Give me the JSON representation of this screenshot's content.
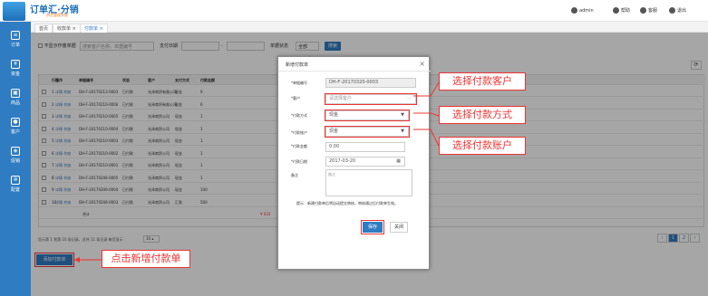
{
  "app": {
    "title": "订单汇·分销",
    "subtitle": "供货管理系统"
  },
  "topbar": {
    "user": "admin",
    "badge": "",
    "help": "帮助",
    "service": "客服",
    "logout": "退出"
  },
  "sidebar": {
    "items": [
      {
        "label": "订单",
        "icon": "list-icon"
      },
      {
        "label": "资金",
        "icon": "yen-icon"
      },
      {
        "label": "商品",
        "icon": "gift-icon"
      },
      {
        "label": "客户",
        "icon": "user-icon"
      },
      {
        "label": "促销",
        "icon": "tag-icon"
      },
      {
        "label": "配置",
        "icon": "gear-icon"
      }
    ]
  },
  "tabs": [
    {
      "label": "首页"
    },
    {
      "label": "收款单 ×"
    },
    {
      "label": "付款单 ×"
    }
  ],
  "filter": {
    "checkbox_label": "不显示作废单据",
    "search_placeholder": "搜索客户名称，单据编号",
    "date_label": "支付日期",
    "status_label": "单据状态",
    "status_value": "全部",
    "search_btn": "搜索"
  },
  "table": {
    "headers": [
      "行号",
      "操作",
      "单据编号",
      "状态",
      "客户",
      "支付方式",
      "付款金额"
    ],
    "rows": [
      [
        "1",
        "详情 作废",
        "DH-F-20170213-0003",
        "已付款",
        "光泽商贸有限公司",
        "现金",
        "9"
      ],
      [
        "2",
        "详情 作废",
        "DH-F-20170210-0006",
        "已付款",
        "光泽商贸有限公司",
        "现金",
        "6"
      ],
      [
        "3",
        "详情 作废",
        "DH-F-20170210-0005",
        "已付款",
        "光泽商贸公司",
        "现金",
        "1"
      ],
      [
        "4",
        "详情 作废",
        "DH-F-20170210-0004",
        "已付款",
        "光泽商贸公司",
        "现金",
        "1"
      ],
      [
        "5",
        "详情 作废",
        "DH-F-20170210-0003",
        "已付款",
        "光泽商贸公司",
        "现金",
        "1"
      ],
      [
        "6",
        "详情 作废",
        "DH-F-20170210-0002",
        "已付款",
        "光泽商贸公司",
        "现金",
        "1"
      ],
      [
        "7",
        "详情 作废",
        "DH-F-20170210-0001",
        "已付款",
        "光泽商贸公司",
        "现金",
        "1"
      ],
      [
        "8",
        "详情 作废",
        "DH-F-20170206-0005",
        "已付款",
        "光泽商贸公司",
        "现金",
        "1"
      ],
      [
        "9",
        "详情 作废",
        "DH-F-20170206-0004",
        "已付款",
        "光泽商贸公司",
        "现金",
        "100"
      ],
      [
        "10",
        "详情 作废",
        "DH-F-20170206-0003",
        "已付款",
        "光泽商贸公司",
        "汇款",
        "500"
      ]
    ],
    "footer_label": "合计",
    "footer_total": "¥ 633"
  },
  "pager": {
    "info": "显示第 1 到第 10 条记录，总共 11 条记录 每页显示",
    "pagesize": "10 ▴",
    "pages": [
      "‹",
      "1",
      "2",
      "›"
    ],
    "suffix": "条记录"
  },
  "add_button": "添加付款单",
  "modal": {
    "title": "新增付款单",
    "labels": {
      "bill_no": "*单据编号",
      "customer": "*客户",
      "method": "*付款方式",
      "account": "*付款账户",
      "amount": "*付款金额",
      "date": "*付款日期",
      "note": "备注"
    },
    "values": {
      "bill_no": "DH-F-20170320-0003",
      "customer_placeholder": "请选择客户",
      "method": "现金",
      "account": "现金",
      "amount": "0.00",
      "date": "2017-03-20",
      "note_placeholder": "备注"
    },
    "tip": "提示：新建付款单后将自动提交审核，审核通过后付款单生效。",
    "save": "保存",
    "close": "关闭"
  },
  "callouts": {
    "customer": "选择付款客户",
    "method": "选择付款方式",
    "account": "选择付款账户",
    "add": "点击新增付款单"
  }
}
